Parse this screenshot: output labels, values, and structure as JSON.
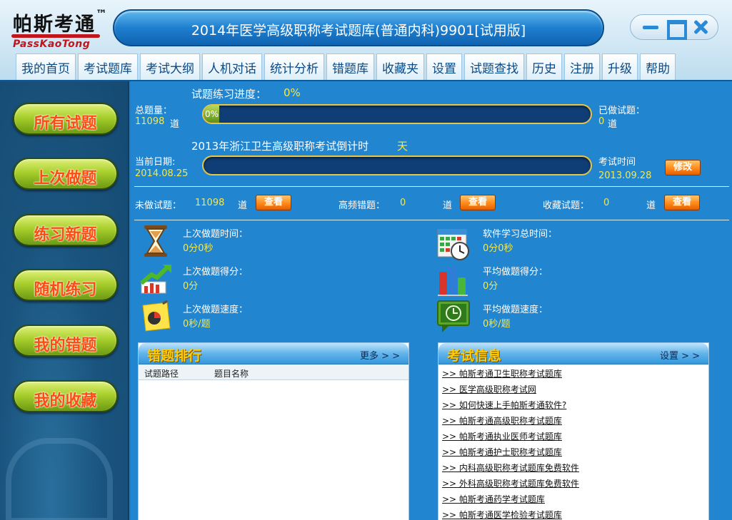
{
  "logo": {
    "cn": "帕斯考通",
    "tm": "™",
    "en": "PassKaoTong"
  },
  "window": {
    "title": "2014年医学高级职称考试题库(普通内科)9901[试用版]"
  },
  "menu": [
    "我的首页",
    "考试题库",
    "考试大纲",
    "人机对话",
    "统计分析",
    "错题库",
    "收藏夹",
    "设置",
    "试题查找",
    "历史",
    "注册",
    "升级",
    "帮助"
  ],
  "sidebar": [
    "所有试题",
    "上次做题",
    "练习新题",
    "随机练习",
    "我的错题",
    "我的收藏"
  ],
  "progress": {
    "label": "试题练习进度：",
    "percent": "0%",
    "percent_value": 0,
    "total_label": "总题量：",
    "total_value": "11098",
    "unit": "道",
    "done_label": "已做试题：",
    "done_value": "0"
  },
  "countdown": {
    "label": "2013年浙江卫生高级职称考试倒计时",
    "days_unit": "天",
    "current_date_label": "当前日期:",
    "current_date": "2014.08.25",
    "exam_time_label": "考试时间",
    "exam_date": "2013.09.28",
    "edit_button": "修改"
  },
  "counts": {
    "undone_label": "未做试题：",
    "undone_value": "11098",
    "frequent_wrong_label": "高频错题：",
    "frequent_wrong_value": "0",
    "favorite_label": "收藏试题：",
    "favorite_value": "0",
    "unit": "道",
    "view_button": "查看"
  },
  "stats": {
    "last_time_label": "上次做题时间：",
    "last_time_value": "0分0秒",
    "total_study_label": "软件学习总时间：",
    "total_study_value": "0分0秒",
    "last_score_label": "上次做题得分：",
    "last_score_value": "0分",
    "avg_score_label": "平均做题得分：",
    "avg_score_value": "0分",
    "last_speed_label": "上次做题速度：",
    "last_speed_value": "0秒/题",
    "avg_speed_label": "平均做题速度：",
    "avg_speed_value": "0秒/题"
  },
  "wrong_ranking": {
    "title": "错题排行",
    "more": "更多 > >",
    "columns": [
      "试题路径",
      "题目名称"
    ]
  },
  "exam_info": {
    "title": "考试信息",
    "settings": "设置 > >",
    "links": [
      ">> 帕斯考通卫生职称考试题库",
      ">> 医学高级职称考试网",
      ">> 如何快速上手帕斯考通软件?",
      ">> 帕斯考通高级职称考试题库",
      ">> 帕斯考通执业医师考试题库",
      ">> 帕斯考通护士职称考试题库",
      ">> 内科高级职称考试题库免费软件",
      ">> 外科高级职称考试题库免费软件",
      ">> 帕斯考通药学考试题库",
      ">> 帕斯考通医学检验考试题库"
    ]
  },
  "colors": {
    "accent": "#2285cf",
    "value_yellow": "#f5e84a",
    "button_orange": "#ff8a1a",
    "sidebar_green": "#a8cf2c"
  },
  "icons": [
    "hourglass-icon",
    "calendar-clock-icon",
    "growth-chart-icon",
    "bar-chart-icon",
    "pie-note-icon",
    "monitor-clock-icon"
  ]
}
